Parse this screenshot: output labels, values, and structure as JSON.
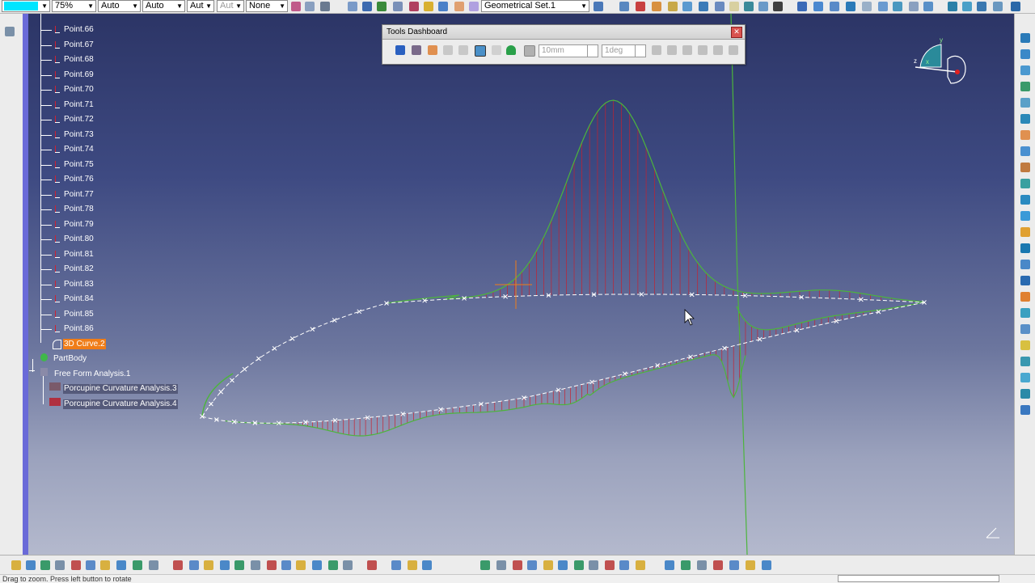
{
  "toolbar": {
    "color_value": "",
    "transparency": "75%",
    "line_thickness": "Auto",
    "line_type": "Auto",
    "point_type": "Aut",
    "layer_disabled": "Aut",
    "layer": "None",
    "geometrical_set": "Geometrical Set.1"
  },
  "tree": {
    "items": [
      {
        "label": "Point.66"
      },
      {
        "label": "Point.67"
      },
      {
        "label": "Point.68"
      },
      {
        "label": "Point.69"
      },
      {
        "label": "Point.70"
      },
      {
        "label": "Point.71"
      },
      {
        "label": "Point.72"
      },
      {
        "label": "Point.73"
      },
      {
        "label": "Point.74"
      },
      {
        "label": "Point.75"
      },
      {
        "label": "Point.76"
      },
      {
        "label": "Point.77"
      },
      {
        "label": "Point.78"
      },
      {
        "label": "Point.79"
      },
      {
        "label": "Point.80"
      },
      {
        "label": "Point.81"
      },
      {
        "label": "Point.82"
      },
      {
        "label": "Point.83"
      },
      {
        "label": "Point.84"
      },
      {
        "label": "Point.85"
      },
      {
        "label": "Point.86"
      }
    ],
    "selected_curve": "3D Curve.2",
    "part_body": "PartBody",
    "analysis": "Free Form Analysis.1",
    "analysis_children": [
      {
        "label": "Porcupine Curvature Analysis.3"
      },
      {
        "label": "Porcupine Curvature Analysis.4"
      }
    ]
  },
  "dashboard": {
    "title": "Tools Dashboard",
    "distance": "10mm",
    "angle": "1deg"
  },
  "compass": {
    "x": "x",
    "y": "y",
    "z": "z"
  },
  "status": {
    "message": "Drag to zoom. Press left button to rotate"
  },
  "colors": {
    "viewport_top": "#2c3566",
    "curve_green": "#4cb53c",
    "porcupine_red": "#c8202e",
    "selection_orange": "#f07d18",
    "color_swatch": "#00e5ff"
  }
}
